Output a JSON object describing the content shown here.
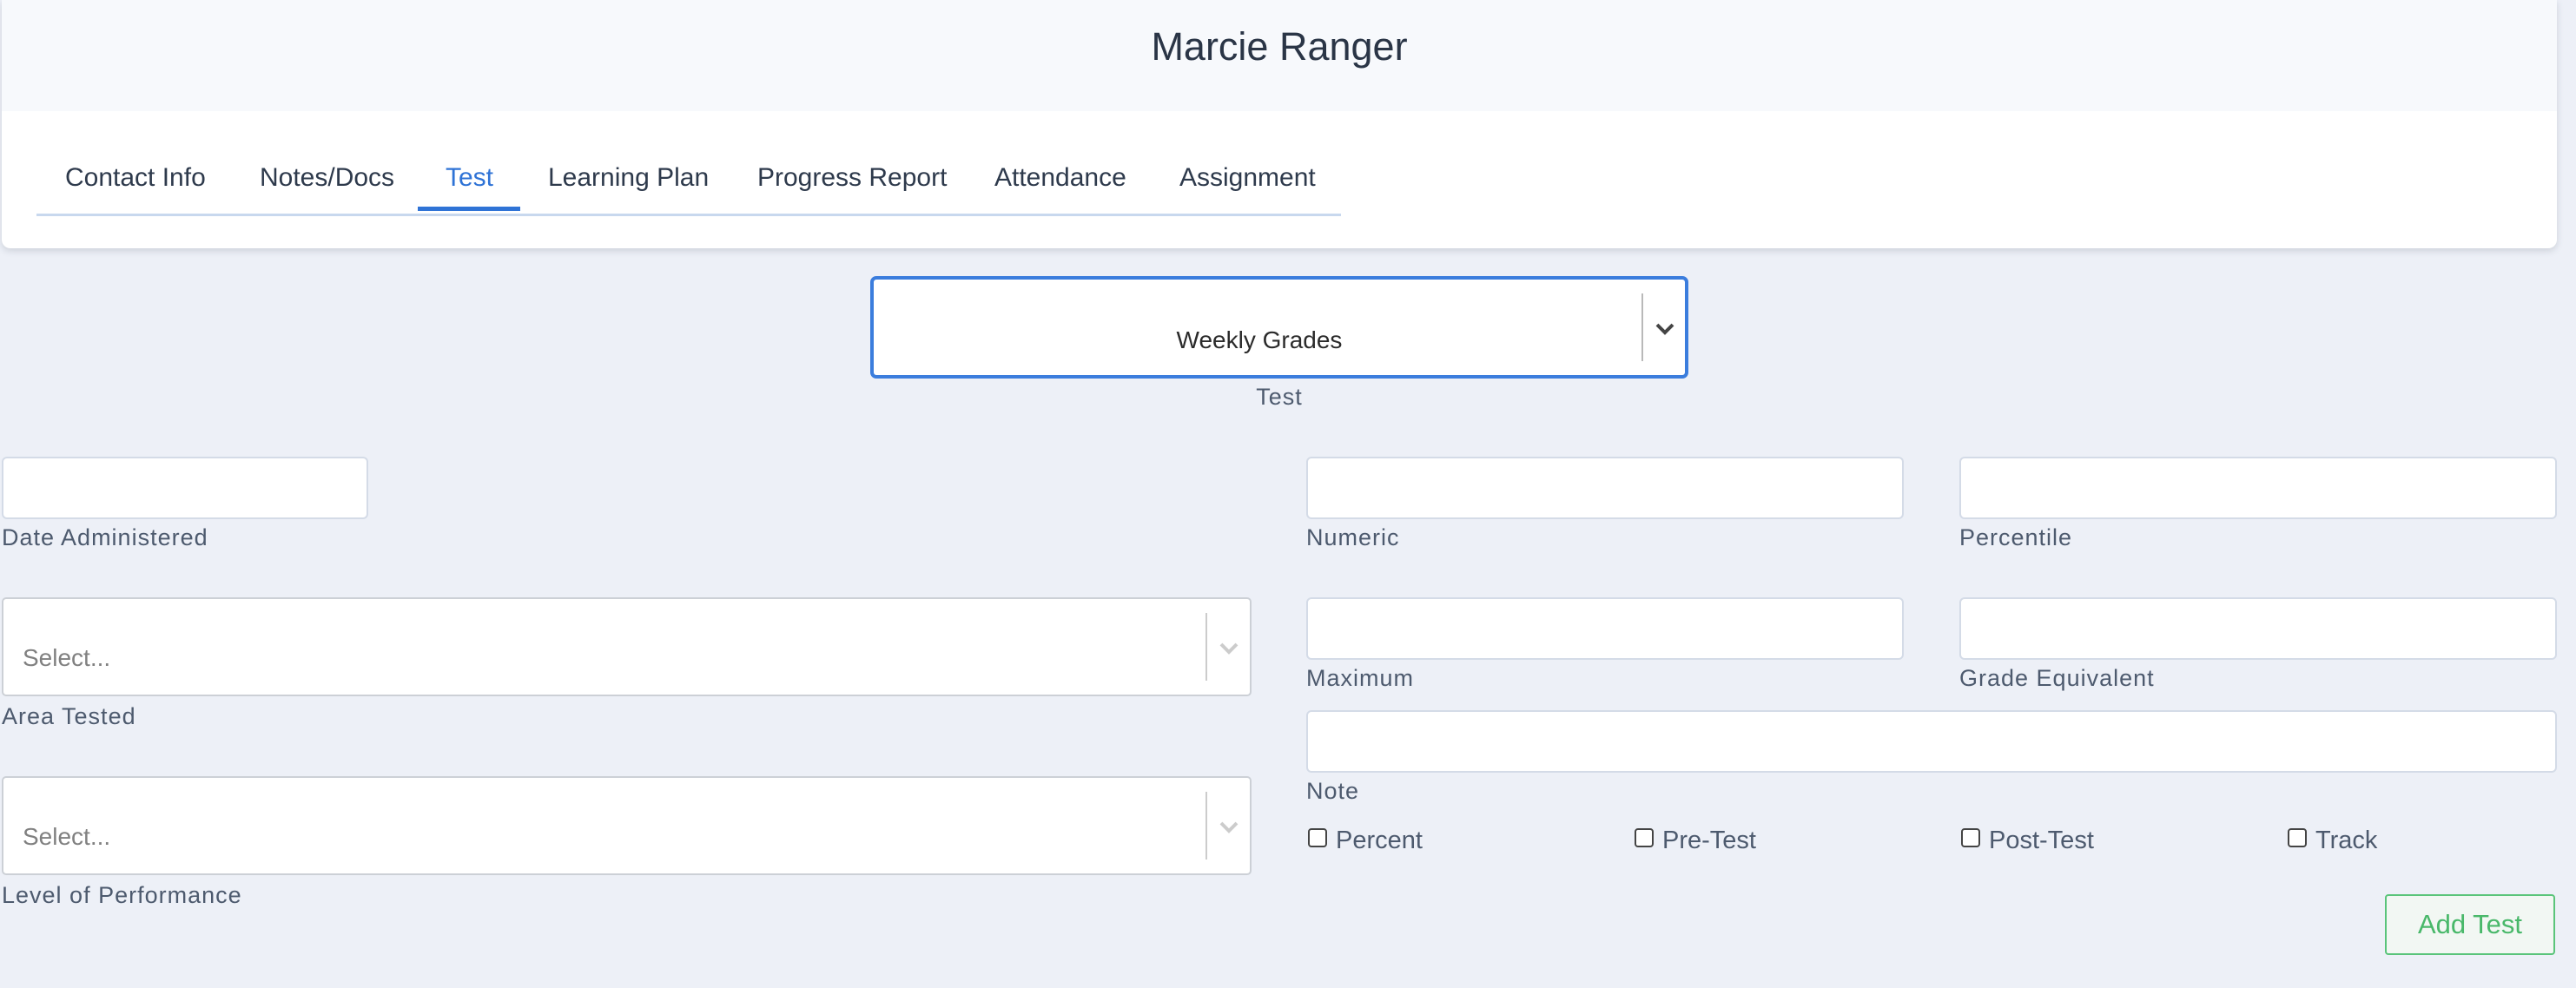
{
  "student_name": "Marcie Ranger",
  "tabs": [
    {
      "label": "Contact Info"
    },
    {
      "label": "Notes/Docs"
    },
    {
      "label": "Test",
      "active": true
    },
    {
      "label": "Learning Plan"
    },
    {
      "label": "Progress Report"
    },
    {
      "label": "Attendance"
    },
    {
      "label": "Assignment"
    }
  ],
  "test_select": {
    "value": "Weekly Grades",
    "label": "Test"
  },
  "fields": {
    "date_administered": {
      "label": "Date Administered",
      "value": ""
    },
    "numeric": {
      "label": "Numeric",
      "value": ""
    },
    "percentile": {
      "label": "Percentile",
      "value": ""
    },
    "maximum": {
      "label": "Maximum",
      "value": ""
    },
    "grade_equivalent": {
      "label": "Grade Equivalent",
      "value": ""
    },
    "note": {
      "label": "Note",
      "value": ""
    }
  },
  "area_tested": {
    "placeholder": "Select...",
    "label": "Area Tested"
  },
  "level_of_performance": {
    "placeholder": "Select...",
    "label": "Level of Performance"
  },
  "checkboxes": [
    {
      "label": "Percent",
      "checked": false
    },
    {
      "label": "Pre-Test",
      "checked": false
    },
    {
      "label": "Post-Test",
      "checked": false
    },
    {
      "label": "Track",
      "checked": false
    }
  ],
  "add_button": "Add Test",
  "colors": {
    "accent": "#2f73d6",
    "success": "#49b86a",
    "background": "#edf0f7"
  }
}
